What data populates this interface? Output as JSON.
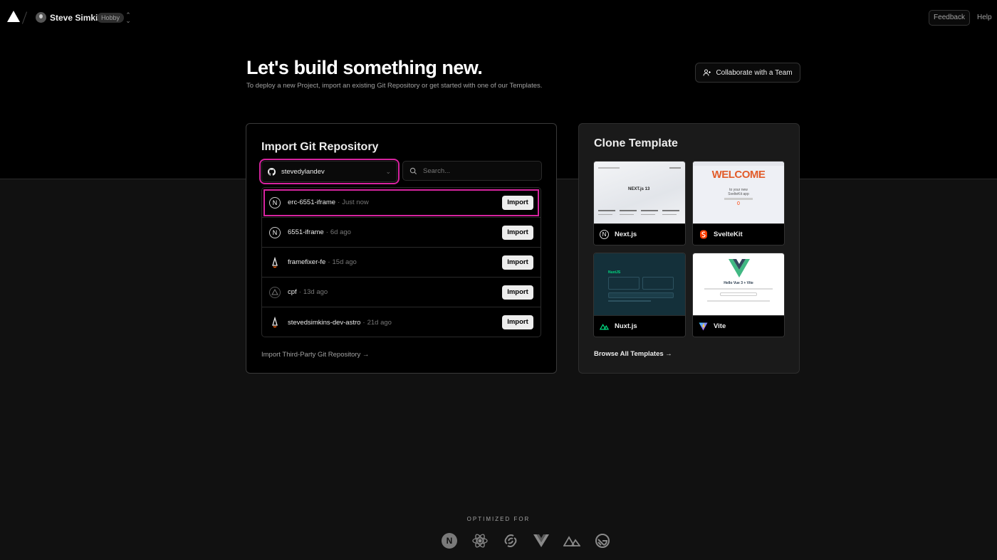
{
  "header": {
    "user_name": "Steve Simkins",
    "plan_badge": "Hobby",
    "feedback_label": "Feedback",
    "help_label": "Help"
  },
  "hero": {
    "title": "Let's build something new.",
    "subtitle": "To deploy a new Project, import an existing Git Repository or get started with one of our Templates.",
    "collaborate_label": "Collaborate with a Team"
  },
  "import_card": {
    "title": "Import Git Repository",
    "account": "stevedylandev",
    "search_placeholder": "Search...",
    "import_button_label": "Import",
    "repos": [
      {
        "name": "erc-6551-iframe",
        "time": "Just now",
        "framework": "nextjs"
      },
      {
        "name": "6551-iframe",
        "time": "6d ago",
        "framework": "nextjs"
      },
      {
        "name": "framefixer-fe",
        "time": "15d ago",
        "framework": "astro"
      },
      {
        "name": "cpf",
        "time": "13d ago",
        "framework": "unknown"
      },
      {
        "name": "stevedsimkins-dev-astro",
        "time": "21d ago",
        "framework": "astro"
      }
    ],
    "third_party_link": "Import Third-Party Git Repository →"
  },
  "clone_card": {
    "title": "Clone Template",
    "templates": [
      {
        "label": "Next.js",
        "icon": "nextjs-icon"
      },
      {
        "label": "SvelteKit",
        "icon": "svelte-icon"
      },
      {
        "label": "Nuxt.js",
        "icon": "nuxt-icon"
      },
      {
        "label": "Vite",
        "icon": "vite-icon"
      }
    ],
    "preview_text": {
      "nextjs_badge": "NEXT.js 13",
      "svelte_welcome": "WELCOME",
      "svelte_sub1": "to your new",
      "svelte_sub2": "SvelteKit app",
      "svelte_counter": "0",
      "nuxt_brand": "NuxtJS",
      "vue_heading": "Hello Vue 3 + Vite"
    },
    "browse_all": "Browse All Templates →"
  },
  "footer": {
    "optimized_for": "OPTIMIZED FOR",
    "frameworks": [
      "nextjs-icon",
      "react-icon",
      "svelte-icon",
      "vue-icon",
      "nuxt-icon",
      "gatsby-icon"
    ]
  },
  "colors": {
    "highlight": "#d6249f",
    "svelte": "#ff3e00",
    "vue_green": "#41b883",
    "nuxt_green": "#00dc82"
  }
}
